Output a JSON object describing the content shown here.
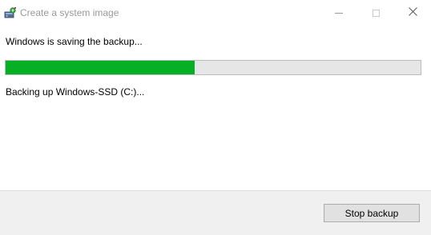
{
  "window": {
    "title": "Create a system image",
    "icon": "backup-drive-icon"
  },
  "controls": {
    "minimize_icon": "minimize-icon",
    "maximize_icon": "maximize-icon",
    "close_icon": "close-icon"
  },
  "progress": {
    "status_text": "Windows is saving the backup...",
    "detail_text": "Backing up Windows-SSD (C:)...",
    "fraction": 0.455,
    "fill_color": "#06b025",
    "track_color": "#e6e6e6"
  },
  "footer": {
    "stop_label": "Stop backup"
  }
}
